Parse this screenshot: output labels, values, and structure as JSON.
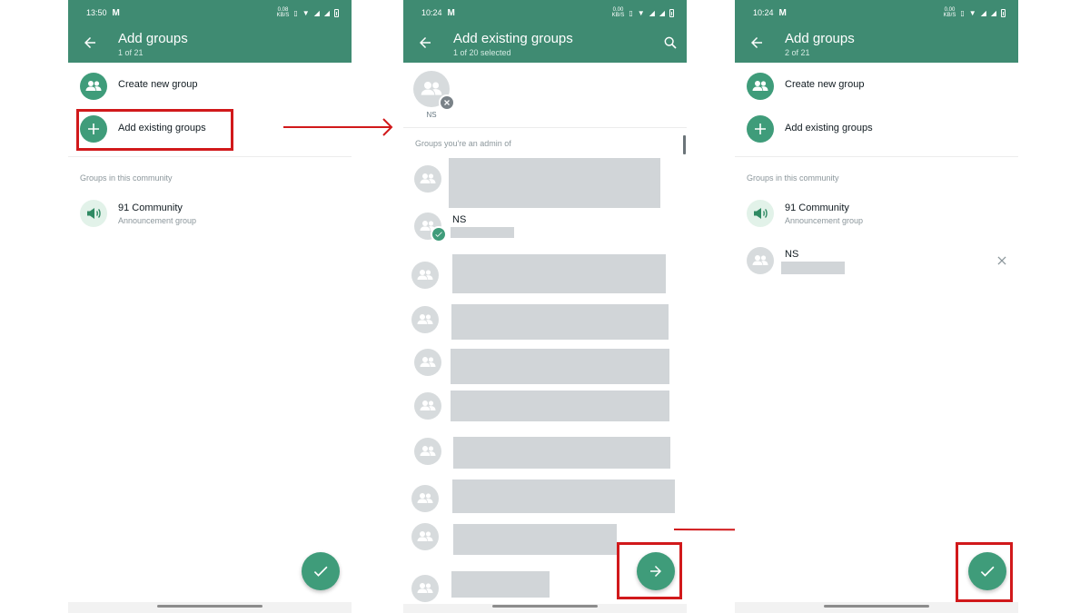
{
  "screen1": {
    "status_time": "13:50",
    "status_speed_top": "0.08",
    "status_speed_bottom": "KB/S",
    "title": "Add groups",
    "subtitle": "1 of 21",
    "create_new_group": "Create new group",
    "add_existing_groups": "Add existing groups",
    "section_label": "Groups in this community",
    "community_name": "91 Community",
    "community_sub": "Announcement group"
  },
  "screen2": {
    "status_time": "10:24",
    "status_speed_top": "0.00",
    "status_speed_bottom": "KB/S",
    "title": "Add existing groups",
    "subtitle": "1 of 20 selected",
    "selected_chip_label": "NS",
    "section_label": "Groups you're an admin of",
    "selected_group_name": "NS"
  },
  "screen3": {
    "status_time": "10:24",
    "status_speed_top": "0.00",
    "status_speed_bottom": "KB/S",
    "title": "Add groups",
    "subtitle": "2 of 21",
    "create_new_group": "Create new group",
    "add_existing_groups": "Add existing groups",
    "section_label": "Groups in this community",
    "community_name": "91 Community",
    "community_sub": "Announcement group",
    "added_group_name": "NS"
  },
  "colors": {
    "appbar": "#3f8b72",
    "accent": "#3f9c7a",
    "highlight": "#d1191b"
  },
  "icons": {
    "back": "arrow-left-icon",
    "search": "search-icon",
    "group": "people-icon",
    "add": "plus-icon",
    "announcement": "megaphone-icon",
    "fab_confirm": "check-icon",
    "fab_next": "arrow-right-icon",
    "remove": "close-icon"
  }
}
